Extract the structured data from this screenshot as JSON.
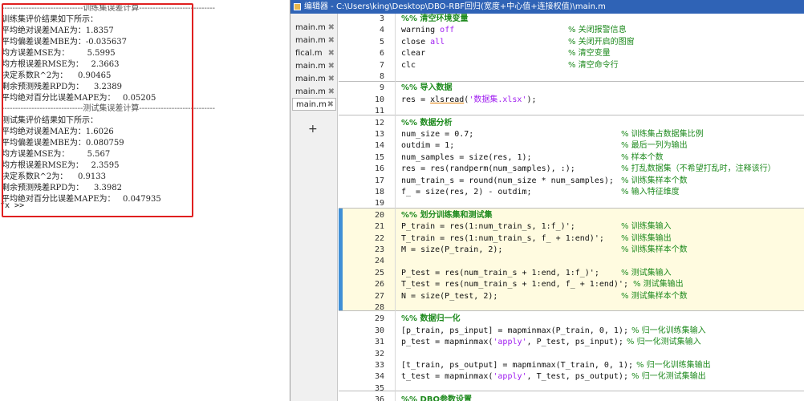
{
  "command_window": {
    "train_header": "------------------------------训练集误差计算----------------------------",
    "train_lines": [
      "训练集评价结果如下所示：",
      "平均绝对误差MAE为：1.8357",
      "平均偏差误差MBE为：-0.035637",
      "均方误差MSE为：       5.5995",
      "均方根误差RMSE为：   2.3663",
      "决定系数R^2为：    0.90465",
      "剩余预测残差RPD为：    3.2389",
      "平均绝对百分比误差MAPE为：   0.05205"
    ],
    "test_header": "------------------------------测试集误差计算----------------------------",
    "test_lines": [
      "测试集评价结果如下所示：",
      "平均绝对误差MAE为：1.6026",
      "平均偏差误差MBE为：0.080759",
      "均方误差MSE为：       5.567",
      "均方根误差RMSE为：   2.3595",
      "决定系数R^2为：    0.9133",
      "剩余预测残差RPD为：    3.3982",
      "平均绝对百分比误差MAPE为：   0.047935"
    ],
    "prompt": "fx >>"
  },
  "editor": {
    "title": "编辑器 - C:\\Users\\king\\Desktop\\DBO-RBF回归(宽度+中心值+连接权值)\\main.m",
    "tabs": [
      {
        "label": "main.m",
        "close": "✖"
      },
      {
        "label": "main.m",
        "close": "✖"
      },
      {
        "label": "fical.m",
        "close": "✖"
      },
      {
        "label": "main.m",
        "close": "✖"
      },
      {
        "label": "main.m",
        "close": "✖"
      },
      {
        "label": "main.m",
        "close": "✖"
      },
      {
        "label": "main.m",
        "close": "✖"
      }
    ],
    "add_tab": "+",
    "lines": [
      {
        "n": "3",
        "code": "%% 清空环境变量",
        "comment": ""
      },
      {
        "n": "4",
        "code": "warning off",
        "comment": "% 关闭报警信息"
      },
      {
        "n": "5",
        "code": "close all",
        "comment": "% 关闭开启的图窗"
      },
      {
        "n": "6",
        "code": "clear",
        "comment": "% 清空变量"
      },
      {
        "n": "7",
        "code": "clc",
        "comment": "% 清空命令行"
      },
      {
        "n": "8",
        "code": "",
        "comment": ""
      },
      {
        "n": "9",
        "code": "%% 导入数据",
        "comment": ""
      },
      {
        "n": "10",
        "code": "res = xlsread('数据集.xlsx');",
        "comment": ""
      },
      {
        "n": "11",
        "code": "",
        "comment": ""
      },
      {
        "n": "12",
        "code": "%% 数据分析",
        "comment": ""
      },
      {
        "n": "13",
        "code": "num_size = 0.7;",
        "comment": "% 训练集占数据集比例"
      },
      {
        "n": "14",
        "code": "outdim = 1;",
        "comment": "% 最后一列为输出"
      },
      {
        "n": "15",
        "code": "num_samples = size(res, 1);",
        "comment": "% 样本个数"
      },
      {
        "n": "16",
        "code": "res = res(randperm(num_samples), :);",
        "comment": "% 打乱数据集（不希望打乱时，注释该行）"
      },
      {
        "n": "17",
        "code": "num_train_s = round(num_size * num_samples);",
        "comment": "% 训练集样本个数"
      },
      {
        "n": "18",
        "code": "f_ = size(res, 2) - outdim;",
        "comment": "% 输入特征维度"
      },
      {
        "n": "19",
        "code": "",
        "comment": ""
      },
      {
        "n": "20",
        "code": "%% 划分训练集和测试集",
        "comment": ""
      },
      {
        "n": "21",
        "code": "P_train = res(1:num_train_s, 1:f_)';",
        "comment": "% 训练集输入"
      },
      {
        "n": "22",
        "code": "T_train = res(1:num_train_s, f_ + 1:end)';",
        "comment": "% 训练集输出"
      },
      {
        "n": "23",
        "code": "M = size(P_train, 2);",
        "comment": "% 训练集样本个数"
      },
      {
        "n": "24",
        "code": "",
        "comment": ""
      },
      {
        "n": "25",
        "code": "P_test = res(num_train_s + 1:end, 1:f_)';",
        "comment": "% 测试集输入"
      },
      {
        "n": "26",
        "code": "T_test = res(num_train_s + 1:end, f_ + 1:end)';",
        "comment": "% 测试集输出"
      },
      {
        "n": "27",
        "code": "N = size(P_test, 2);",
        "comment": "% 测试集样本个数"
      },
      {
        "n": "28",
        "code": "",
        "comment": ""
      },
      {
        "n": "29",
        "code": "%% 数据归一化",
        "comment": ""
      },
      {
        "n": "30",
        "code": "[p_train, ps_input] = mapminmax(P_train, 0, 1);",
        "comment": "% 归一化训练集输入"
      },
      {
        "n": "31",
        "code": "p_test = mapminmax('apply', P_test, ps_input);",
        "comment": "% 归一化测试集输入"
      },
      {
        "n": "32",
        "code": "",
        "comment": ""
      },
      {
        "n": "33",
        "code": "[t_train, ps_output] = mapminmax(T_train, 0, 1);",
        "comment": "% 归一化训练集输出"
      },
      {
        "n": "34",
        "code": "t_test = mapminmax('apply', T_test, ps_output);",
        "comment": "% 归一化测试集输出"
      },
      {
        "n": "35",
        "code": "",
        "comment": ""
      },
      {
        "n": "36",
        "code": "%% DBO参数设置",
        "comment": ""
      }
    ]
  }
}
